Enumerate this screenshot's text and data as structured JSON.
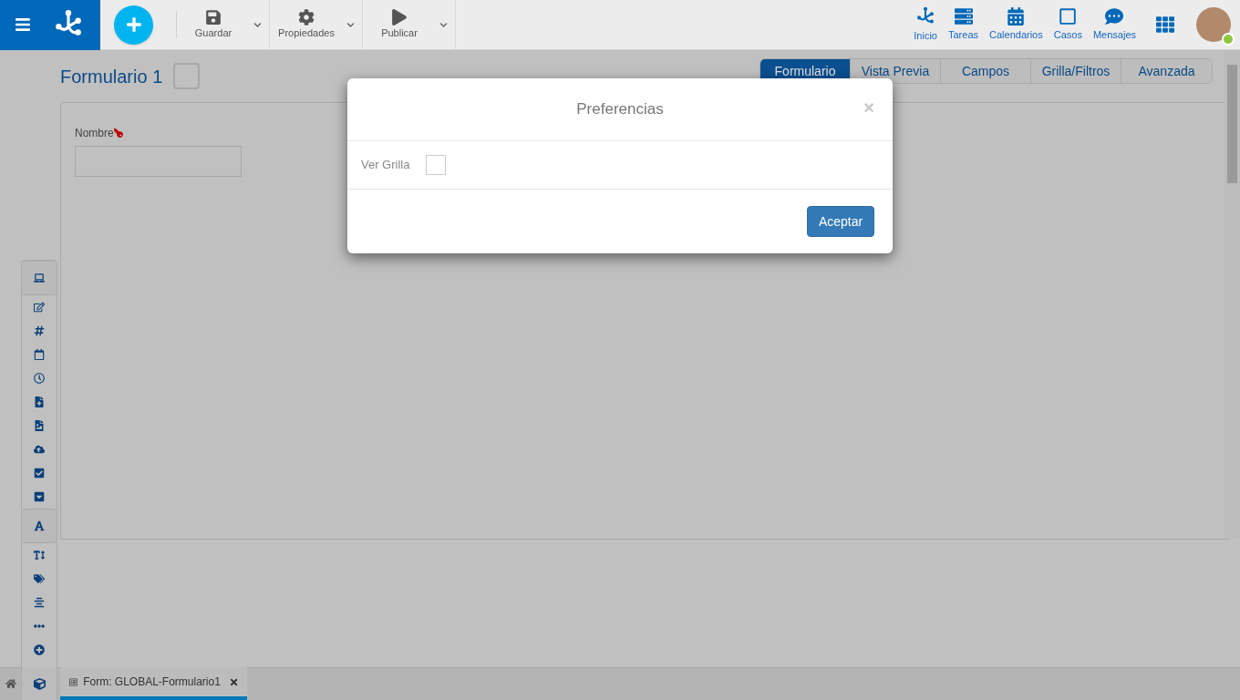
{
  "toolbar": [
    {
      "label": "Guardar",
      "kind": "save"
    },
    {
      "label": "Propiedades",
      "kind": "properties"
    },
    {
      "label": "Publicar",
      "kind": "publish"
    }
  ],
  "nav": [
    {
      "label": "Inicio",
      "kind": "home"
    },
    {
      "label": "Tareas",
      "kind": "tasks"
    },
    {
      "label": "Calendarios",
      "kind": "calendar"
    },
    {
      "label": "Casos",
      "kind": "cases"
    },
    {
      "label": "Mensajes",
      "kind": "messages"
    }
  ],
  "user": {
    "online": true
  },
  "form": {
    "title": "Formulario 1",
    "fields": [
      {
        "label": "Nombre",
        "key": true
      }
    ]
  },
  "tabs": [
    {
      "label": "Formulario",
      "selected": true
    },
    {
      "label": "Vista Previa",
      "selected": false
    },
    {
      "label": "Campos",
      "selected": false
    },
    {
      "label": "Grilla/Filtros",
      "selected": false
    },
    {
      "label": "Avanzada",
      "selected": false
    }
  ],
  "dialog": {
    "title": "Preferencias",
    "close": "×",
    "option": {
      "label": "Ver Grilla",
      "checked": false
    },
    "button": "Aceptar"
  },
  "bottom_tab": {
    "label": "Form: GLOBAL-Formulario1",
    "selected": true
  }
}
